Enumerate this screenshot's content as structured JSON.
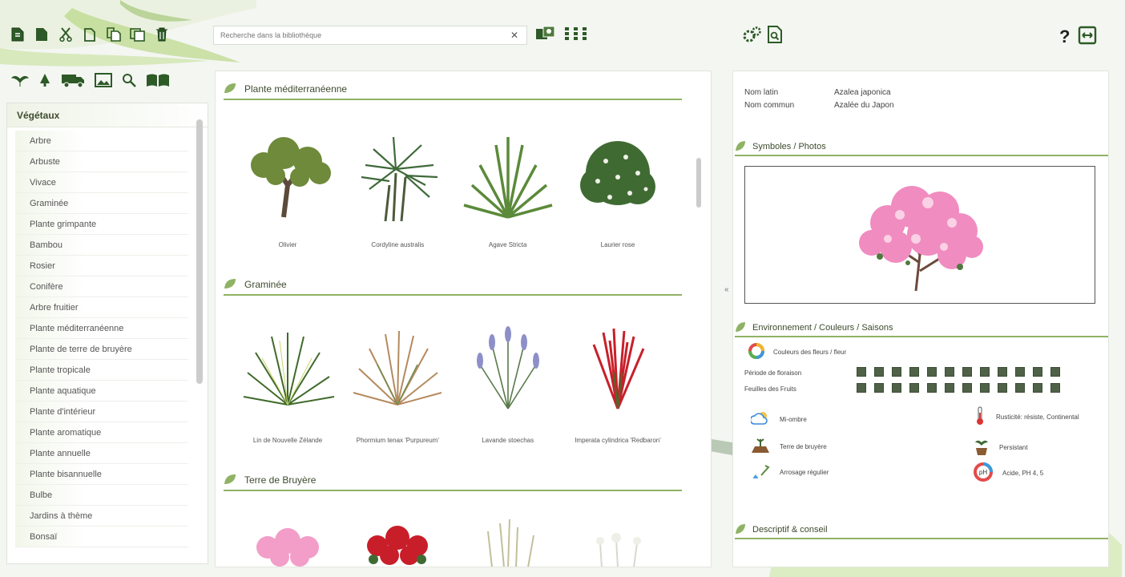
{
  "toolbar": {
    "icons": [
      "new-file-icon",
      "open-file-icon",
      "cut-icon",
      "copy-icon",
      "paste-icon",
      "duplicate-icon",
      "delete-icon"
    ],
    "search_placeholder": "Recherche dans la bibliothèque",
    "view_icons": [
      "photo-view-icon",
      "grid-view-icon"
    ]
  },
  "category_icons": [
    "vegetal-icon",
    "tree-icon",
    "truck-icon",
    "image-icon",
    "search-icon",
    "library-icon"
  ],
  "sidebar": {
    "title": "Végétaux",
    "items": [
      "Arbre",
      "Arbuste",
      "Vivace",
      "Graminée",
      "Plante grimpante",
      "Bambou",
      "Rosier",
      "Conifère",
      "Arbre fruitier",
      "Plante méditerranéenne",
      "Plante de terre de bruyère",
      "Plante tropicale",
      "Plante aquatique",
      "Plante d'intérieur",
      "Plante aromatique",
      "Plante annuelle",
      "Plante bisannuelle",
      "Bulbe",
      "Jardins à thème",
      "Bonsaï"
    ]
  },
  "main": {
    "sections": [
      {
        "title": "Plante méditerranéenne",
        "plants": [
          {
            "label": "Olivier",
            "type": "olive"
          },
          {
            "label": "Cordyline australis",
            "type": "palm"
          },
          {
            "label": "Agave Stricta",
            "type": "agave"
          },
          {
            "label": "Laurier rose",
            "type": "shrub"
          }
        ]
      },
      {
        "title": "Graminée",
        "plants": [
          {
            "label": "Lin de Nouvelle Zélande",
            "type": "grass-green"
          },
          {
            "label": "Phormium tenax 'Purpureum'",
            "type": "grass-brown"
          },
          {
            "label": "Lavande stoechas",
            "type": "grass-lavender"
          },
          {
            "label": "Imperata cylindrica 'Redbaron'",
            "type": "grass-red"
          }
        ]
      },
      {
        "title": "Terre de Bruyère",
        "plants": [
          {
            "label": "",
            "type": "pink"
          },
          {
            "label": "",
            "type": "red"
          },
          {
            "label": "",
            "type": "tall-grass"
          },
          {
            "label": "",
            "type": "white-flower"
          }
        ]
      }
    ]
  },
  "detail": {
    "top_icons": [
      "settings-icon",
      "preview-icon"
    ],
    "help_label": "?",
    "nom_latin_label": "Nom latin",
    "nom_latin_value": "Azalea japonica",
    "nom_commun_label": "Nom commun",
    "nom_commun_value": "Azalée du Japon",
    "symbols_title": "Symboles / Photos",
    "env_title": "Environnement / Couleurs / Saisons",
    "couleurs_label": "Couleurs des fleurs / fleur",
    "floraison_label": "Période de floraison",
    "feuilles_label": "Feuilles des Fruits",
    "env_items": [
      {
        "label": "Mi-ombre",
        "icon": "cloud-sun-icon"
      },
      {
        "label": "Terre de bruyère",
        "icon": "soil-icon"
      },
      {
        "label": "Arrosage régulier",
        "icon": "watering-icon"
      },
      {
        "label": "Rusticité: résiste, Continental",
        "icon": "thermometer-icon"
      },
      {
        "label": "Persistant",
        "icon": "leaf-pot-icon"
      },
      {
        "label": "Acide, PH 4, 5",
        "icon": "ph-gauge-icon"
      }
    ],
    "desc_title": "Descriptif & conseil"
  },
  "colors": {
    "accent": "#8fb265",
    "square": "#4f6147"
  }
}
